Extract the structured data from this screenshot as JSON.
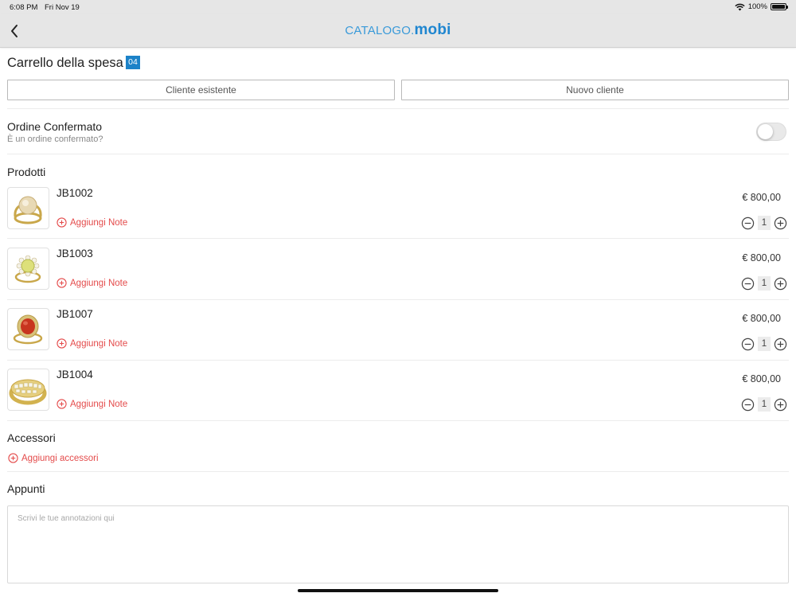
{
  "status_bar": {
    "time": "6:08 PM",
    "date": "Fri Nov 19",
    "battery": "100%"
  },
  "nav": {
    "logo_part1": "CATALOGO.",
    "logo_part2": "mobi"
  },
  "cart": {
    "title": "Carrello della spesa",
    "count": "04"
  },
  "buttons": {
    "existing_client": "Cliente esistente",
    "new_client": "Nuovo cliente"
  },
  "order_confirmed": {
    "title": "Ordine Confermato",
    "subtitle": "È un ordine confermato?",
    "enabled": false
  },
  "products": {
    "title": "Prodotti",
    "items": [
      {
        "code": "JB1002",
        "price": "€ 800,00",
        "qty": "1",
        "note_label": "Aggiungi Note"
      },
      {
        "code": "JB1003",
        "price": "€ 800,00",
        "qty": "1",
        "note_label": "Aggiungi Note"
      },
      {
        "code": "JB1007",
        "price": "€ 800,00",
        "qty": "1",
        "note_label": "Aggiungi Note"
      },
      {
        "code": "JB1004",
        "price": "€ 800,00",
        "qty": "1",
        "note_label": "Aggiungi Note"
      }
    ]
  },
  "accessories": {
    "title": "Accessori",
    "add_label": "Aggiungi accessori"
  },
  "notes": {
    "title": "Appunti",
    "placeholder": "Scrivi le tue annotazioni qui",
    "value": ""
  },
  "colors": {
    "accent": "#1c82c8",
    "action_red": "#e44b4b",
    "bar_gray": "#e6e6e6"
  }
}
